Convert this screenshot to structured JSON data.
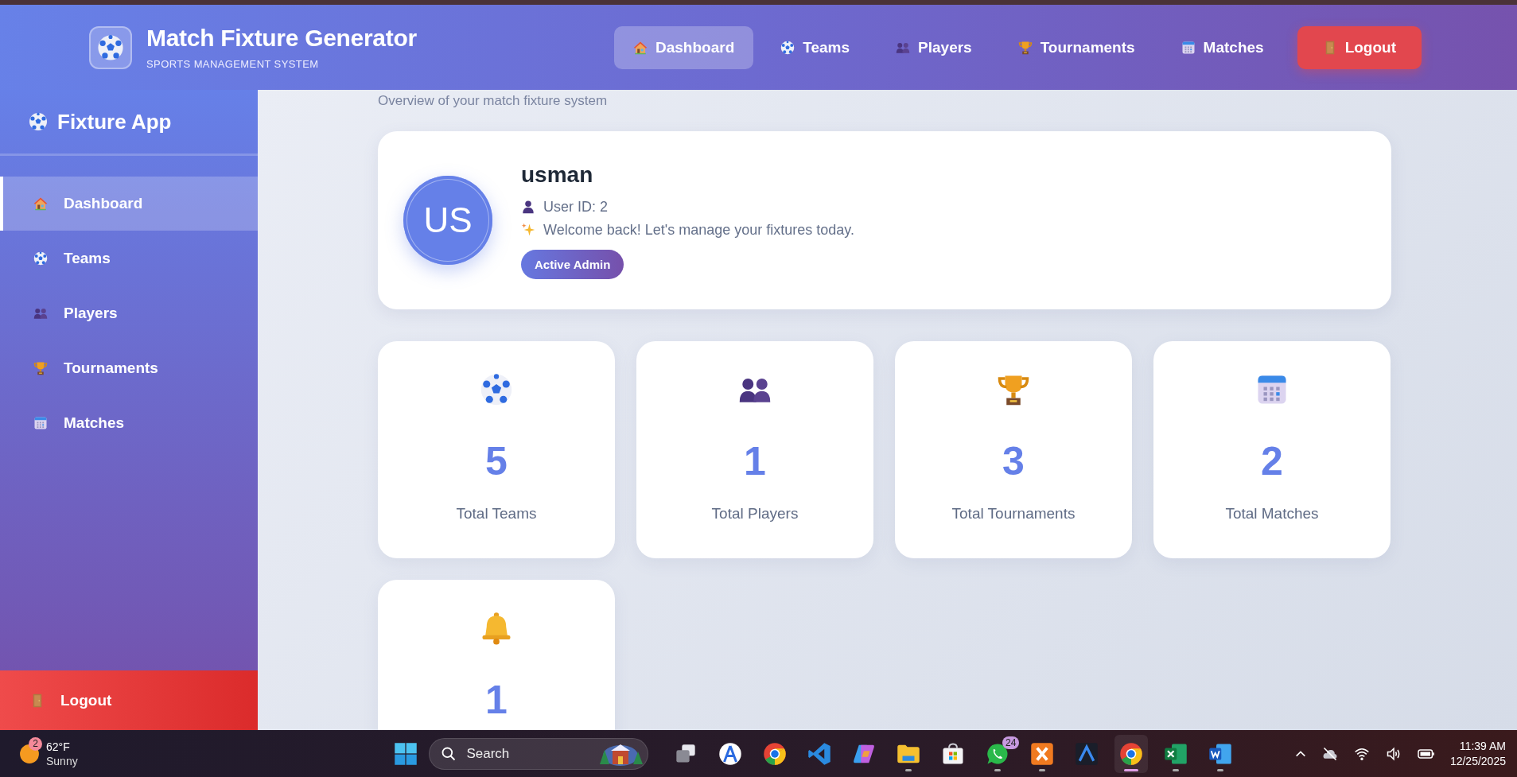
{
  "header": {
    "title": "Match Fixture Generator",
    "subtitle": "SPORTS MANAGEMENT SYSTEM",
    "nav": [
      {
        "label": "Dashboard",
        "kind": "house",
        "selected": true
      },
      {
        "label": "Teams",
        "kind": "ball",
        "selected": false
      },
      {
        "label": "Players",
        "kind": "people",
        "selected": false
      },
      {
        "label": "Tournaments",
        "kind": "trophy",
        "selected": false
      },
      {
        "label": "Matches",
        "kind": "calendar",
        "selected": false
      }
    ],
    "logout": "Logout"
  },
  "sidebar": {
    "brand": "Fixture App",
    "items": [
      {
        "label": "Dashboard",
        "kind": "house",
        "selected": true
      },
      {
        "label": "Teams",
        "kind": "ball",
        "selected": false
      },
      {
        "label": "Players",
        "kind": "people",
        "selected": false
      },
      {
        "label": "Tournaments",
        "kind": "trophy",
        "selected": false
      },
      {
        "label": "Matches",
        "kind": "calendar",
        "selected": false
      }
    ],
    "logout": "Logout"
  },
  "main": {
    "subtitle": "Overview of your match fixture system",
    "profile": {
      "initials": "US",
      "name": "usman",
      "user_id": "User ID: 2",
      "welcome": "Welcome back! Let's manage your fixtures today.",
      "badge": "Active Admin"
    },
    "stats": [
      {
        "kind": "ball",
        "value": "5",
        "label": "Total Teams"
      },
      {
        "kind": "people",
        "value": "1",
        "label": "Total Players"
      },
      {
        "kind": "trophy",
        "value": "3",
        "label": "Total Tournaments"
      },
      {
        "kind": "calendar",
        "value": "2",
        "label": "Total Matches"
      },
      {
        "kind": "bell",
        "value": "1"
      }
    ]
  },
  "taskbar": {
    "weather": {
      "badge": "2",
      "temp": "62°F",
      "condition": "Sunny"
    },
    "search": {
      "placeholder": "Search"
    },
    "apps": [
      {
        "kind": "task-view",
        "running": false,
        "selected": false
      },
      {
        "kind": "compass",
        "running": false,
        "selected": false
      },
      {
        "kind": "chrome",
        "running": false,
        "selected": false
      },
      {
        "kind": "code",
        "running": false,
        "selected": false
      },
      {
        "kind": "copilot",
        "running": false,
        "selected": false
      },
      {
        "kind": "folder",
        "running": true,
        "selected": false
      },
      {
        "kind": "store",
        "running": false,
        "selected": false
      },
      {
        "kind": "chat",
        "running": true,
        "selected": false,
        "badge": "24"
      },
      {
        "kind": "xampp",
        "running": true,
        "selected": false
      },
      {
        "kind": "a-logo",
        "running": false,
        "selected": false
      },
      {
        "kind": "chrome",
        "running": true,
        "selected": true
      },
      {
        "kind": "sheet",
        "running": true,
        "selected": false
      },
      {
        "kind": "doc",
        "running": true,
        "selected": false
      }
    ],
    "clock": {
      "time": "11:39 AM",
      "date": "12/25/2025"
    }
  }
}
